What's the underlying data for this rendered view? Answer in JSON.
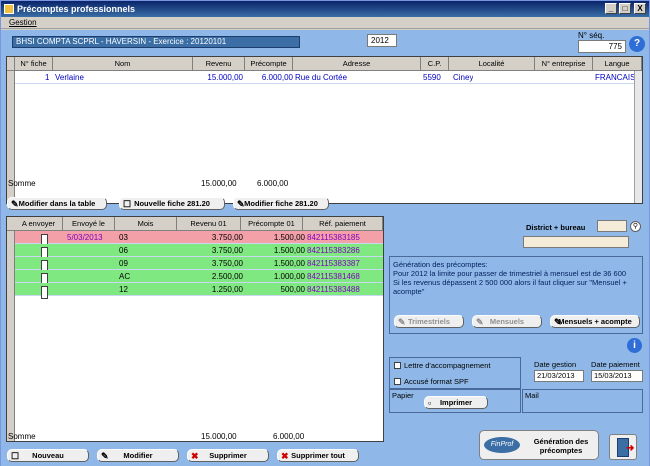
{
  "window": {
    "title": "Précomptes professionnels",
    "minimize": "_",
    "maximize": "□",
    "close": "X"
  },
  "menu": {
    "gestion": "Gestion"
  },
  "header": {
    "company": "BHSI COMPTA SCPRL  - HAVERSIN - Exercice : 20120101",
    "year": "2012",
    "seq_label": "N° séq.",
    "seq_value": "775",
    "help_icon": "question-icon"
  },
  "top_table": {
    "columns": [
      "N° fiche",
      "Nom",
      "Revenu",
      "Précompte",
      "Adresse",
      "C.P.",
      "Localité",
      "N° entreprise",
      "Langue"
    ],
    "rows": [
      {
        "fiche": "1",
        "nom": "Verlaine",
        "revenu": "15.000,00",
        "precompte": "6.000,00",
        "adresse": "Rue du Cortée",
        "cp": "5590",
        "localite": "Ciney",
        "entreprise": "",
        "langue": "FRANCAIS"
      }
    ],
    "sum_label": "Somme",
    "sum_revenu": "15.000,00",
    "sum_precompte": "6.000,00"
  },
  "top_buttons": {
    "modifier_table": "Modifier dans la table",
    "nouvelle_fiche": "Nouvelle fiche 281.20",
    "modifier_fiche": "Modifier fiche 281.20"
  },
  "bottom_table": {
    "columns": [
      "A envoyer",
      "Envoyé le",
      "Mois",
      "Revenu 01",
      "Précompte 01",
      "Réf. paiement"
    ],
    "rows": [
      {
        "envoye": "5/03/2013",
        "mois": "03",
        "revenu": "3.750,00",
        "precompte": "1.500,00",
        "ref": "842115383185"
      },
      {
        "envoye": "",
        "mois": "06",
        "revenu": "3.750,00",
        "precompte": "1.500,00",
        "ref": "842115383286"
      },
      {
        "envoye": "",
        "mois": "09",
        "revenu": "3.750,00",
        "precompte": "1.500,00",
        "ref": "842115383387"
      },
      {
        "envoye": "",
        "mois": "AC",
        "revenu": "2.500,00",
        "precompte": "1.000,00",
        "ref": "842115381468"
      },
      {
        "envoye": "",
        "mois": "12",
        "revenu": "1.250,00",
        "precompte": "500,00",
        "ref": "842115383488"
      }
    ],
    "sum_label": "Somme",
    "sum_revenu": "15.000,00",
    "sum_precompte": "6.000,00"
  },
  "right_panel": {
    "district_label": "District + bureau",
    "gen_title": "Génération des précomptes:",
    "gen_line1": "Pour 2012 la limite pour passer de trimestriel à mensuel est de 36 600",
    "gen_line2": "Si les revenus dépassent 2 500 000 alors il faut cliquer sur \"Mensuel + acompte\"",
    "btn_trim": "Trimestriels",
    "btn_mens": "Mensuels",
    "btn_mens_ac": "Mensuels + acompte",
    "lettre": "Lettre d'accompagnement",
    "accuse": "Accusé format SPF",
    "date_gestion_label": "Date gestion",
    "date_gestion": "21/03/2013",
    "date_paiement_label": "Date paiement",
    "date_paiement": "15/03/2013",
    "papier": "Papier",
    "mail": "Mail",
    "imprimer": "Imprimer",
    "gen_btn": "Génération des précomptes",
    "finprof": "FinProf"
  },
  "bottom_buttons": {
    "nouveau": "Nouveau",
    "modifier": "Modifier",
    "supprimer": "Supprimer",
    "supprimer_tout": "Supprimer tout"
  },
  "colors": {
    "title": "#0a246a",
    "client": "#8fb8e8",
    "selected_row": "#f4a0a8",
    "green_row": "#80e880",
    "header_box": "#3a6ea5"
  }
}
